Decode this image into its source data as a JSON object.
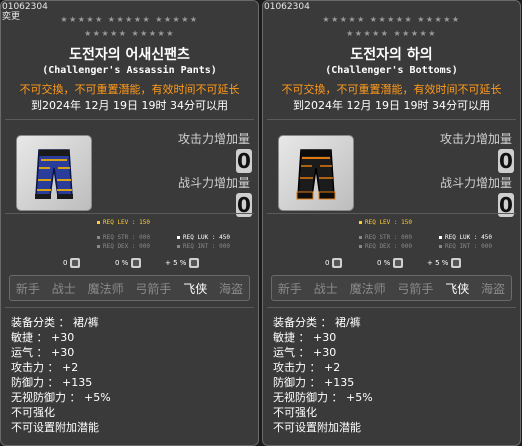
{
  "items": [
    {
      "id_text": "01062304",
      "sub_text": "奕更",
      "stars_row1": "★★★★★ ★★★★★ ★★★★★",
      "stars_row2": "★★★★★ ★★★★★",
      "name_kr": "도전자의 어새신팬츠",
      "name_en": "(Challenger's Assassin Pants)",
      "warning": "不可交換，不可重置潛能，有效时间不可延长",
      "expire": "到2024年 12月 19日 19时 34分可以用",
      "attack_label": "攻击力增加量",
      "attack_value": "0",
      "combat_label": "战斗力增加量",
      "combat_value": "0",
      "req_lev": "REQ LEV : 150",
      "req_str": "REQ STR : 000",
      "req_luk": "REQ LUK : 450",
      "req_dex": "REQ DEX : 000",
      "req_int": "REQ INT : 000",
      "mini1": "0",
      "mini2": "0 %",
      "mini3": "+ 5 %",
      "jobs": [
        "新手",
        "战士",
        "魔法师",
        "弓箭手",
        "飞侠",
        "海盗"
      ],
      "active_job": "飞侠",
      "lines": [
        "装备分类 ： 裙/裤",
        "敏捷 ： +30",
        "运气 ： +30",
        "攻击力 ： +2",
        "防御力 ： +135",
        "无视防御力 ： +5%",
        "不可强化",
        "不可设置附加潜能"
      ],
      "colors": {
        "main": "#2a3d9a",
        "trim": "#d4a017",
        "dark": "#1a1a1a"
      }
    },
    {
      "id_text": "01062304",
      "stars_row1": "★★★★★ ★★★★★ ★★★★★",
      "stars_row2": "★★★★★ ★★★★★",
      "name_kr": "도전자의 하의",
      "name_en": "(Challenger's Bottoms)",
      "warning": "不可交換，不可重置潛能，有效时间不可延长",
      "expire": "到2024年 12月 19日 19时 34分可以用",
      "attack_label": "攻击力增加量",
      "attack_value": "0",
      "combat_label": "战斗力增加量",
      "combat_value": "0",
      "req_lev": "REQ LEV : 150",
      "req_str": "REQ STR : 000",
      "req_luk": "REQ LUK : 450",
      "req_dex": "REQ DEX : 000",
      "req_int": "REQ INT : 000",
      "mini1": "0",
      "mini2": "0 %",
      "mini3": "+ 5 %",
      "jobs": [
        "新手",
        "战士",
        "魔法师",
        "弓箭手",
        "飞侠",
        "海盗"
      ],
      "active_job": "飞侠",
      "lines": [
        "装备分类 ： 裙/裤",
        "敏捷 ： +30",
        "运气 ： +30",
        "攻击力 ： +2",
        "防御力 ： +135",
        "无视防御力 ： +5%",
        "不可强化",
        "不可设置附加潜能"
      ],
      "colors": {
        "main": "#1b1b1b",
        "trim": "#e07a10",
        "dark": "#0c0c0c"
      }
    }
  ]
}
